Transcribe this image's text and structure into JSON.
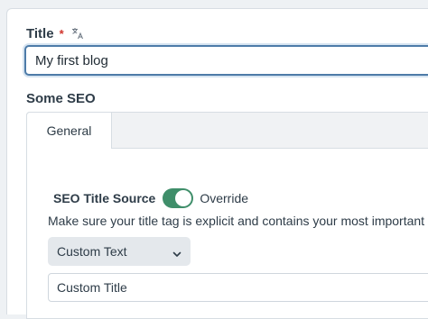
{
  "title_field": {
    "label": "Title",
    "required_marker": "*",
    "translate_icon": "translate-icon",
    "value": "My first blog"
  },
  "seo_section": {
    "label": "Some SEO",
    "tabs": [
      {
        "label": "General",
        "active": true
      }
    ],
    "seo_title_source": {
      "label": "SEO Title Source",
      "toggle_on": true,
      "toggle_text": "Override"
    },
    "help_text": "Make sure your title tag is explicit and contains your most important",
    "select": {
      "selected": "Custom Text",
      "icon": "chevron-down-icon"
    },
    "custom_title": {
      "value": "Custom Title"
    }
  },
  "colors": {
    "accent_border": "#4d7ba8",
    "toggle_on": "#3f8e6a",
    "required": "#d0342c"
  }
}
